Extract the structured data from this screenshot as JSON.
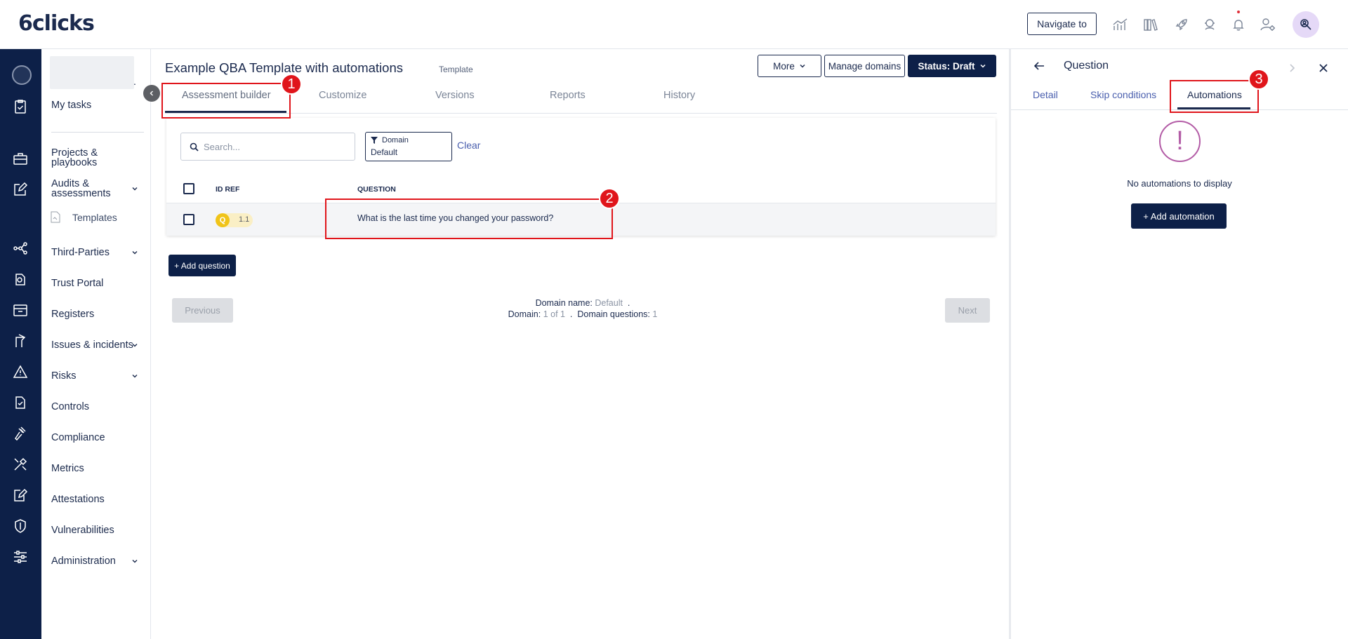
{
  "app": {
    "logo": "6clicks",
    "navigate_to_label": "Navigate to"
  },
  "sidebar": {
    "dot": ".",
    "items": [
      {
        "label": "My tasks"
      },
      {
        "label": "Projects & playbooks"
      },
      {
        "label": "Audits & assessments"
      },
      {
        "label": "Templates"
      },
      {
        "label": "Third-Parties"
      },
      {
        "label": "Trust Portal"
      },
      {
        "label": "Registers"
      },
      {
        "label": "Issues & incidents"
      },
      {
        "label": "Risks"
      },
      {
        "label": "Controls"
      },
      {
        "label": "Compliance"
      },
      {
        "label": "Metrics"
      },
      {
        "label": "Attestations"
      },
      {
        "label": "Vulnerabilities"
      },
      {
        "label": "Administration"
      }
    ]
  },
  "header": {
    "title": "Example QBA Template with automations",
    "chip": "Template",
    "more_label": "More",
    "manage_domains_label": "Manage domains",
    "status_label": "Status: Draft"
  },
  "tabs": [
    {
      "label": "Assessment builder"
    },
    {
      "label": "Customize"
    },
    {
      "label": "Versions"
    },
    {
      "label": "Reports"
    },
    {
      "label": "History"
    }
  ],
  "filters": {
    "search_placeholder": "Search...",
    "domain_label": "Domain",
    "domain_value": "Default",
    "clear_label": "Clear"
  },
  "table": {
    "columns": [
      "ID REF",
      "QUESTION"
    ],
    "rows": [
      {
        "badge": "Q",
        "id_ref": "1.1",
        "question": "What is the last time you changed your password?"
      }
    ]
  },
  "add_question_label": "+ Add question",
  "pagination": {
    "previous_label": "Previous",
    "next_label": "Next",
    "domain_name_label": "Domain name:",
    "domain_name_value": "Default",
    "sep": ".",
    "domain_label": "Domain:",
    "domain_value": "1 of 1",
    "domain_questions_label": "Domain questions:",
    "domain_questions_value": "1"
  },
  "drawer": {
    "title": "Question",
    "tabs": [
      {
        "label": "Detail"
      },
      {
        "label": "Skip conditions"
      },
      {
        "label": "Automations"
      }
    ],
    "empty_icon_glyph": "!",
    "empty_text": "No automations to display",
    "add_automation_label": "+ Add automation"
  },
  "annotations": [
    "1",
    "2",
    "3"
  ],
  "colors": {
    "navy": "#0d2048",
    "accent_link": "#4a5fae",
    "highlight": "#e0151b",
    "warning": "#b35ca6",
    "badge_yellow": "#f0c419"
  },
  "icons": {
    "top": [
      "analytics-icon",
      "library-icon",
      "rocket-icon",
      "support-icon",
      "bell-icon",
      "user-settings-icon"
    ],
    "rail": [
      "avatar-icon",
      "tasks-icon",
      "briefcase-icon",
      "edit-icon",
      "network-icon",
      "portal-icon",
      "register-icon",
      "incident-icon",
      "warning-icon",
      "controls-icon",
      "gavel-icon",
      "tools-icon",
      "attestation-icon",
      "shield-icon",
      "sliders-icon"
    ]
  }
}
